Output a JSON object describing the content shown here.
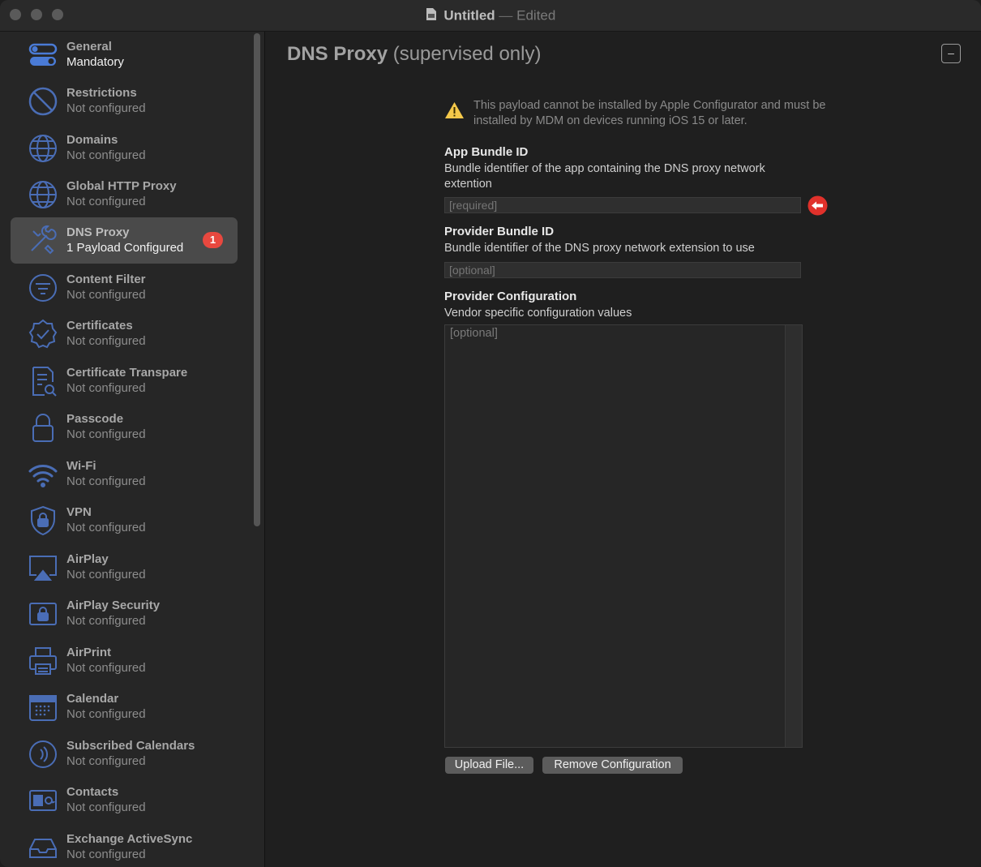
{
  "window": {
    "title": "Untitled",
    "separator": "—",
    "status": "Edited"
  },
  "sidebar": {
    "items": [
      {
        "title": "General",
        "subtitle": "Mandatory",
        "icon": "toggle-icon"
      },
      {
        "title": "Restrictions",
        "subtitle": "Not configured",
        "icon": "prohibited-icon"
      },
      {
        "title": "Domains",
        "subtitle": "Not configured",
        "icon": "globe-icon"
      },
      {
        "title": "Global HTTP Proxy",
        "subtitle": "Not configured",
        "icon": "globe-icon"
      },
      {
        "title": "DNS Proxy",
        "subtitle": "1 Payload Configured",
        "icon": "tools-icon",
        "badge": "1"
      },
      {
        "title": "Content Filter",
        "subtitle": "Not configured",
        "icon": "filter-icon"
      },
      {
        "title": "Certificates",
        "subtitle": "Not configured",
        "icon": "seal-check-icon"
      },
      {
        "title": "Certificate Transpare",
        "subtitle": "Not configured",
        "icon": "document-search-icon"
      },
      {
        "title": "Passcode",
        "subtitle": "Not configured",
        "icon": "lock-icon"
      },
      {
        "title": "Wi-Fi",
        "subtitle": "Not configured",
        "icon": "wifi-icon"
      },
      {
        "title": "VPN",
        "subtitle": "Not configured",
        "icon": "shield-lock-icon"
      },
      {
        "title": "AirPlay",
        "subtitle": "Not configured",
        "icon": "airplay-icon"
      },
      {
        "title": "AirPlay Security",
        "subtitle": "Not configured",
        "icon": "lock-box-icon"
      },
      {
        "title": "AirPrint",
        "subtitle": "Not configured",
        "icon": "printer-icon"
      },
      {
        "title": "Calendar",
        "subtitle": "Not configured",
        "icon": "calendar-icon"
      },
      {
        "title": "Subscribed Calendars",
        "subtitle": "Not configured",
        "icon": "broadcast-icon"
      },
      {
        "title": "Contacts",
        "subtitle": "Not configured",
        "icon": "contact-card-icon"
      },
      {
        "title": "Exchange ActiveSync",
        "subtitle": "Not configured",
        "icon": "inbox-icon"
      }
    ]
  },
  "main": {
    "title": "DNS Proxy",
    "title_suffix": "(supervised only)",
    "collapse_label": "–",
    "warning": "This payload cannot be installed by Apple Configurator and must be installed by MDM on devices running iOS 15 or later.",
    "app_bundle": {
      "label": "App Bundle ID",
      "description": "Bundle identifier of the app containing the DNS proxy network extention",
      "placeholder": "[required]"
    },
    "provider_bundle": {
      "label": "Provider Bundle ID",
      "description": "Bundle identifier of the DNS proxy network extension to use",
      "placeholder": "[optional]"
    },
    "provider_config": {
      "label": "Provider Configuration",
      "description": "Vendor specific configuration values",
      "placeholder": "[optional]"
    },
    "upload_button": "Upload File...",
    "remove_button": "Remove Configuration"
  },
  "colors": {
    "badge": "#e8483f",
    "warning": "#f5c84a",
    "error": "#e0312b",
    "selected_row": "#4a4a4a"
  }
}
